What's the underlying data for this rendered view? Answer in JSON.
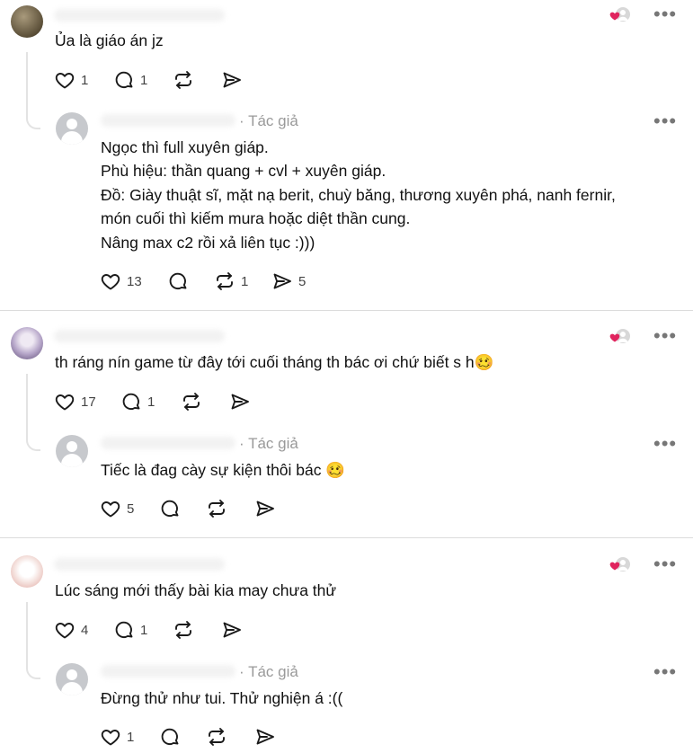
{
  "author_tag": "· Tác giả",
  "threads": [
    {
      "comment": {
        "text": "Ủa là giáo án jz",
        "likes": "1",
        "replies": "1",
        "reposts": "",
        "shares": ""
      },
      "reply": {
        "lines": [
          "Ngọc thì full xuyên giáp.",
          "Phù hiệu: thần quang + cvl + xuyên giáp.",
          "Đồ: Giày thuật sĩ, mặt nạ berit, chuỳ băng, thương xuyên phá, nanh fernir,",
          "món cuối thì kiếm mura hoặc diệt thần cung.",
          "Nâng max c2 rồi xả liên tục :)))"
        ],
        "likes": "13",
        "replies": "",
        "reposts": "1",
        "shares": "5"
      }
    },
    {
      "comment": {
        "text": "th ráng nín game từ đây tới cuối tháng th bác ơi chứ biết s h🥴",
        "likes": "17",
        "replies": "1",
        "reposts": "",
        "shares": ""
      },
      "reply": {
        "lines": [
          "Tiếc là đag cày sự kiện thôi bác 🥴"
        ],
        "likes": "5",
        "replies": "",
        "reposts": "",
        "shares": ""
      }
    },
    {
      "comment": {
        "text": "Lúc sáng mới thấy bài kia may chưa thử",
        "likes": "4",
        "replies": "1",
        "reposts": "",
        "shares": ""
      },
      "reply": {
        "lines": [
          "Đừng thử như tui. Thử nghiện á :(("
        ],
        "likes": "1",
        "replies": "",
        "reposts": "",
        "shares": ""
      }
    }
  ],
  "icons": {
    "like": "heart-icon",
    "reply": "comment-icon",
    "repost": "repost-icon",
    "share": "send-icon",
    "more": "more-icon",
    "liked_by_author": "liked-by-author-icon"
  },
  "colors": {
    "heart_red": "#e0245e",
    "icon": "#1a1a1a",
    "muted": "#9a9a9a"
  }
}
